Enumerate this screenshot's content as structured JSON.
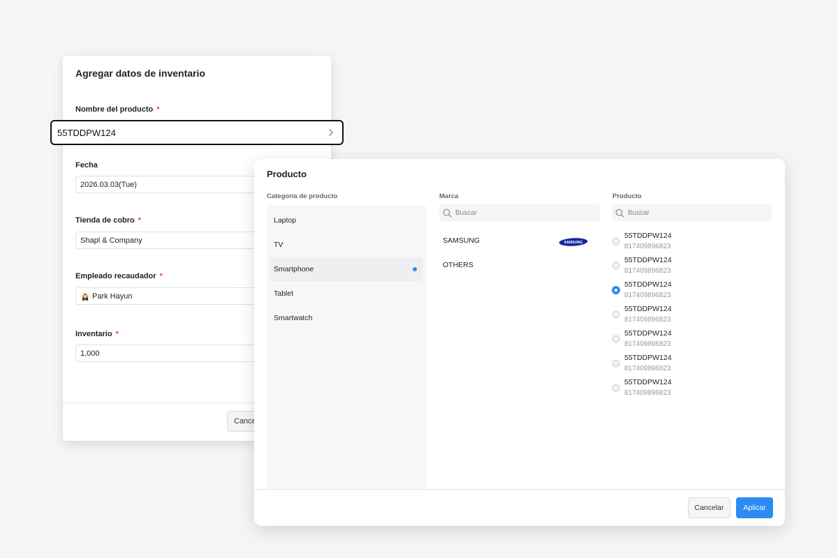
{
  "inventory_form": {
    "title": "Agregar datos de inventario",
    "product_name_label": "Nombre del producto",
    "product_name_value": "55TDDPW124",
    "date_label": "Fecha",
    "date_value": "2026.03.03(Tue)",
    "store_label": "Tienda de cobro",
    "store_value": "Shapl & Company",
    "employee_label": "Empleado recaudador",
    "employee_value": "Park Hayun",
    "inventory_label": "Inventario",
    "inventory_value": "1,000",
    "required_mark": "*",
    "cancel_label": "Cance"
  },
  "product_picker": {
    "title": "Producto",
    "category_header": "Categoría de producto",
    "brand_header": "Marca",
    "product_header": "Producto",
    "search_placeholder": "Buscar",
    "categories": [
      "Laptop",
      "TV",
      "Smartphone",
      "Tablet",
      "Smartwatch"
    ],
    "selected_category": "Smartphone",
    "brands": [
      "SAMSUNG",
      "OTHERS"
    ],
    "samsung_logo_text": "SAMSUNG",
    "products": [
      {
        "name": "55TDDPW124",
        "code": "817409896823"
      },
      {
        "name": "55TDDPW124",
        "code": "817409896823"
      },
      {
        "name": "55TDDPW124",
        "code": "817409896823"
      },
      {
        "name": "55TDDPW124",
        "code": "817409896823"
      },
      {
        "name": "55TDDPW124",
        "code": "817409896823"
      },
      {
        "name": "55TDDPW124",
        "code": "817409896823"
      },
      {
        "name": "55TDDPW124",
        "code": "817409896823"
      }
    ],
    "selected_product_index": 2,
    "cancel_label": "Cancelar",
    "apply_label": "Aplicar"
  },
  "colors": {
    "accent": "#2c8cf4",
    "required": "#e5484d",
    "background": "#f5f5f7"
  },
  "icons": {
    "chevron": "chevron-right-icon",
    "search": "search-icon",
    "radio": "radio-icon",
    "avatar": "avatar"
  }
}
